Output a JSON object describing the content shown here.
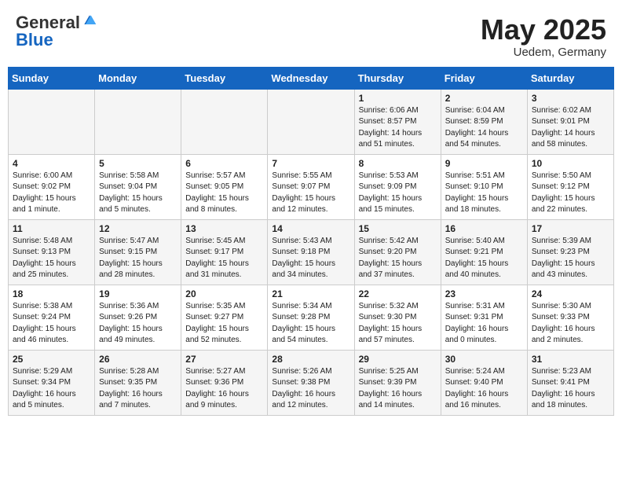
{
  "header": {
    "logo_general": "General",
    "logo_blue": "Blue",
    "title": "May 2025",
    "subtitle": "Uedem, Germany"
  },
  "days_of_week": [
    "Sunday",
    "Monday",
    "Tuesday",
    "Wednesday",
    "Thursday",
    "Friday",
    "Saturday"
  ],
  "weeks": [
    [
      {
        "day": "",
        "content": ""
      },
      {
        "day": "",
        "content": ""
      },
      {
        "day": "",
        "content": ""
      },
      {
        "day": "",
        "content": ""
      },
      {
        "day": "1",
        "content": "Sunrise: 6:06 AM\nSunset: 8:57 PM\nDaylight: 14 hours\nand 51 minutes."
      },
      {
        "day": "2",
        "content": "Sunrise: 6:04 AM\nSunset: 8:59 PM\nDaylight: 14 hours\nand 54 minutes."
      },
      {
        "day": "3",
        "content": "Sunrise: 6:02 AM\nSunset: 9:01 PM\nDaylight: 14 hours\nand 58 minutes."
      }
    ],
    [
      {
        "day": "4",
        "content": "Sunrise: 6:00 AM\nSunset: 9:02 PM\nDaylight: 15 hours\nand 1 minute."
      },
      {
        "day": "5",
        "content": "Sunrise: 5:58 AM\nSunset: 9:04 PM\nDaylight: 15 hours\nand 5 minutes."
      },
      {
        "day": "6",
        "content": "Sunrise: 5:57 AM\nSunset: 9:05 PM\nDaylight: 15 hours\nand 8 minutes."
      },
      {
        "day": "7",
        "content": "Sunrise: 5:55 AM\nSunset: 9:07 PM\nDaylight: 15 hours\nand 12 minutes."
      },
      {
        "day": "8",
        "content": "Sunrise: 5:53 AM\nSunset: 9:09 PM\nDaylight: 15 hours\nand 15 minutes."
      },
      {
        "day": "9",
        "content": "Sunrise: 5:51 AM\nSunset: 9:10 PM\nDaylight: 15 hours\nand 18 minutes."
      },
      {
        "day": "10",
        "content": "Sunrise: 5:50 AM\nSunset: 9:12 PM\nDaylight: 15 hours\nand 22 minutes."
      }
    ],
    [
      {
        "day": "11",
        "content": "Sunrise: 5:48 AM\nSunset: 9:13 PM\nDaylight: 15 hours\nand 25 minutes."
      },
      {
        "day": "12",
        "content": "Sunrise: 5:47 AM\nSunset: 9:15 PM\nDaylight: 15 hours\nand 28 minutes."
      },
      {
        "day": "13",
        "content": "Sunrise: 5:45 AM\nSunset: 9:17 PM\nDaylight: 15 hours\nand 31 minutes."
      },
      {
        "day": "14",
        "content": "Sunrise: 5:43 AM\nSunset: 9:18 PM\nDaylight: 15 hours\nand 34 minutes."
      },
      {
        "day": "15",
        "content": "Sunrise: 5:42 AM\nSunset: 9:20 PM\nDaylight: 15 hours\nand 37 minutes."
      },
      {
        "day": "16",
        "content": "Sunrise: 5:40 AM\nSunset: 9:21 PM\nDaylight: 15 hours\nand 40 minutes."
      },
      {
        "day": "17",
        "content": "Sunrise: 5:39 AM\nSunset: 9:23 PM\nDaylight: 15 hours\nand 43 minutes."
      }
    ],
    [
      {
        "day": "18",
        "content": "Sunrise: 5:38 AM\nSunset: 9:24 PM\nDaylight: 15 hours\nand 46 minutes."
      },
      {
        "day": "19",
        "content": "Sunrise: 5:36 AM\nSunset: 9:26 PM\nDaylight: 15 hours\nand 49 minutes."
      },
      {
        "day": "20",
        "content": "Sunrise: 5:35 AM\nSunset: 9:27 PM\nDaylight: 15 hours\nand 52 minutes."
      },
      {
        "day": "21",
        "content": "Sunrise: 5:34 AM\nSunset: 9:28 PM\nDaylight: 15 hours\nand 54 minutes."
      },
      {
        "day": "22",
        "content": "Sunrise: 5:32 AM\nSunset: 9:30 PM\nDaylight: 15 hours\nand 57 minutes."
      },
      {
        "day": "23",
        "content": "Sunrise: 5:31 AM\nSunset: 9:31 PM\nDaylight: 16 hours\nand 0 minutes."
      },
      {
        "day": "24",
        "content": "Sunrise: 5:30 AM\nSunset: 9:33 PM\nDaylight: 16 hours\nand 2 minutes."
      }
    ],
    [
      {
        "day": "25",
        "content": "Sunrise: 5:29 AM\nSunset: 9:34 PM\nDaylight: 16 hours\nand 5 minutes."
      },
      {
        "day": "26",
        "content": "Sunrise: 5:28 AM\nSunset: 9:35 PM\nDaylight: 16 hours\nand 7 minutes."
      },
      {
        "day": "27",
        "content": "Sunrise: 5:27 AM\nSunset: 9:36 PM\nDaylight: 16 hours\nand 9 minutes."
      },
      {
        "day": "28",
        "content": "Sunrise: 5:26 AM\nSunset: 9:38 PM\nDaylight: 16 hours\nand 12 minutes."
      },
      {
        "day": "29",
        "content": "Sunrise: 5:25 AM\nSunset: 9:39 PM\nDaylight: 16 hours\nand 14 minutes."
      },
      {
        "day": "30",
        "content": "Sunrise: 5:24 AM\nSunset: 9:40 PM\nDaylight: 16 hours\nand 16 minutes."
      },
      {
        "day": "31",
        "content": "Sunrise: 5:23 AM\nSunset: 9:41 PM\nDaylight: 16 hours\nand 18 minutes."
      }
    ]
  ]
}
